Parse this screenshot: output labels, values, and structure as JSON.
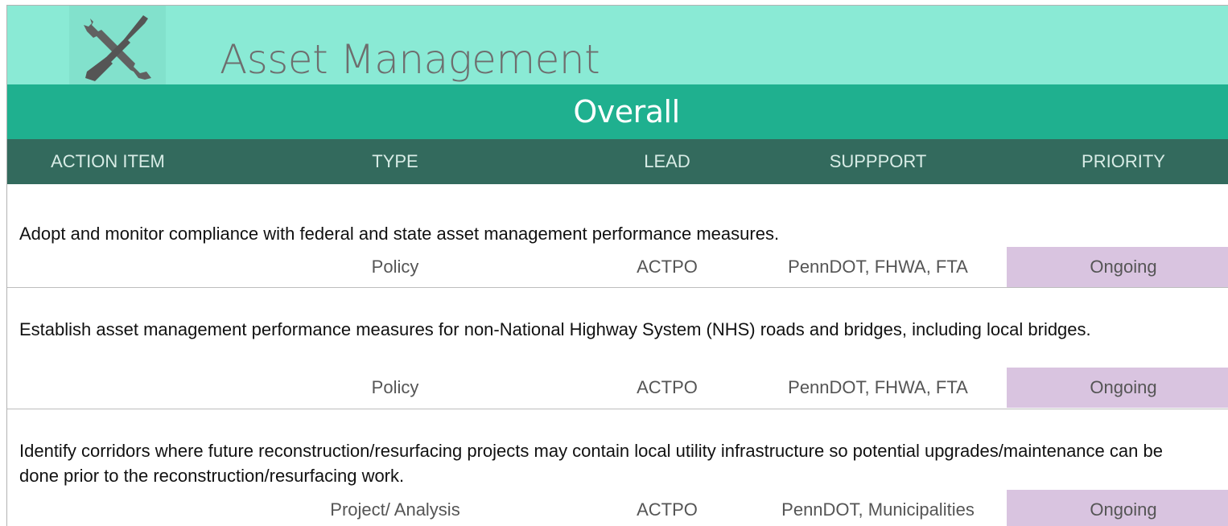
{
  "header": {
    "title": "Asset Management",
    "logo_icon": "tools-icon",
    "section": "Overall",
    "colors": {
      "title_band": "#8aead5",
      "section_band": "#1fb08f",
      "header_row": "#336a5d",
      "priority_cell": "#d9c4e0"
    }
  },
  "columns": [
    "ACTION ITEM",
    "TYPE",
    "LEAD",
    "SUPPPORT",
    "PRIORITY"
  ],
  "rows": [
    {
      "action": "Adopt and monitor compliance with federal and state asset management performance measures.",
      "type": "Policy",
      "lead": "ACTPO",
      "support": "PennDOT, FHWA, FTA",
      "priority": "Ongoing"
    },
    {
      "action": "Establish asset management performance measures for non-National Highway System (NHS) roads and bridges, including local bridges.",
      "type": "Policy",
      "lead": "ACTPO",
      "support": "PennDOT, FHWA, FTA",
      "priority": "Ongoing"
    },
    {
      "action": "Identify corridors where future reconstruction/resurfacing projects may contain local utility infrastructure so potential upgrades/maintenance can be done prior to the reconstruction/resurfacing work.",
      "type": "Project/ Analysis",
      "lead": "ACTPO",
      "support": "PennDOT, Municipalities",
      "priority": "Ongoing"
    }
  ]
}
